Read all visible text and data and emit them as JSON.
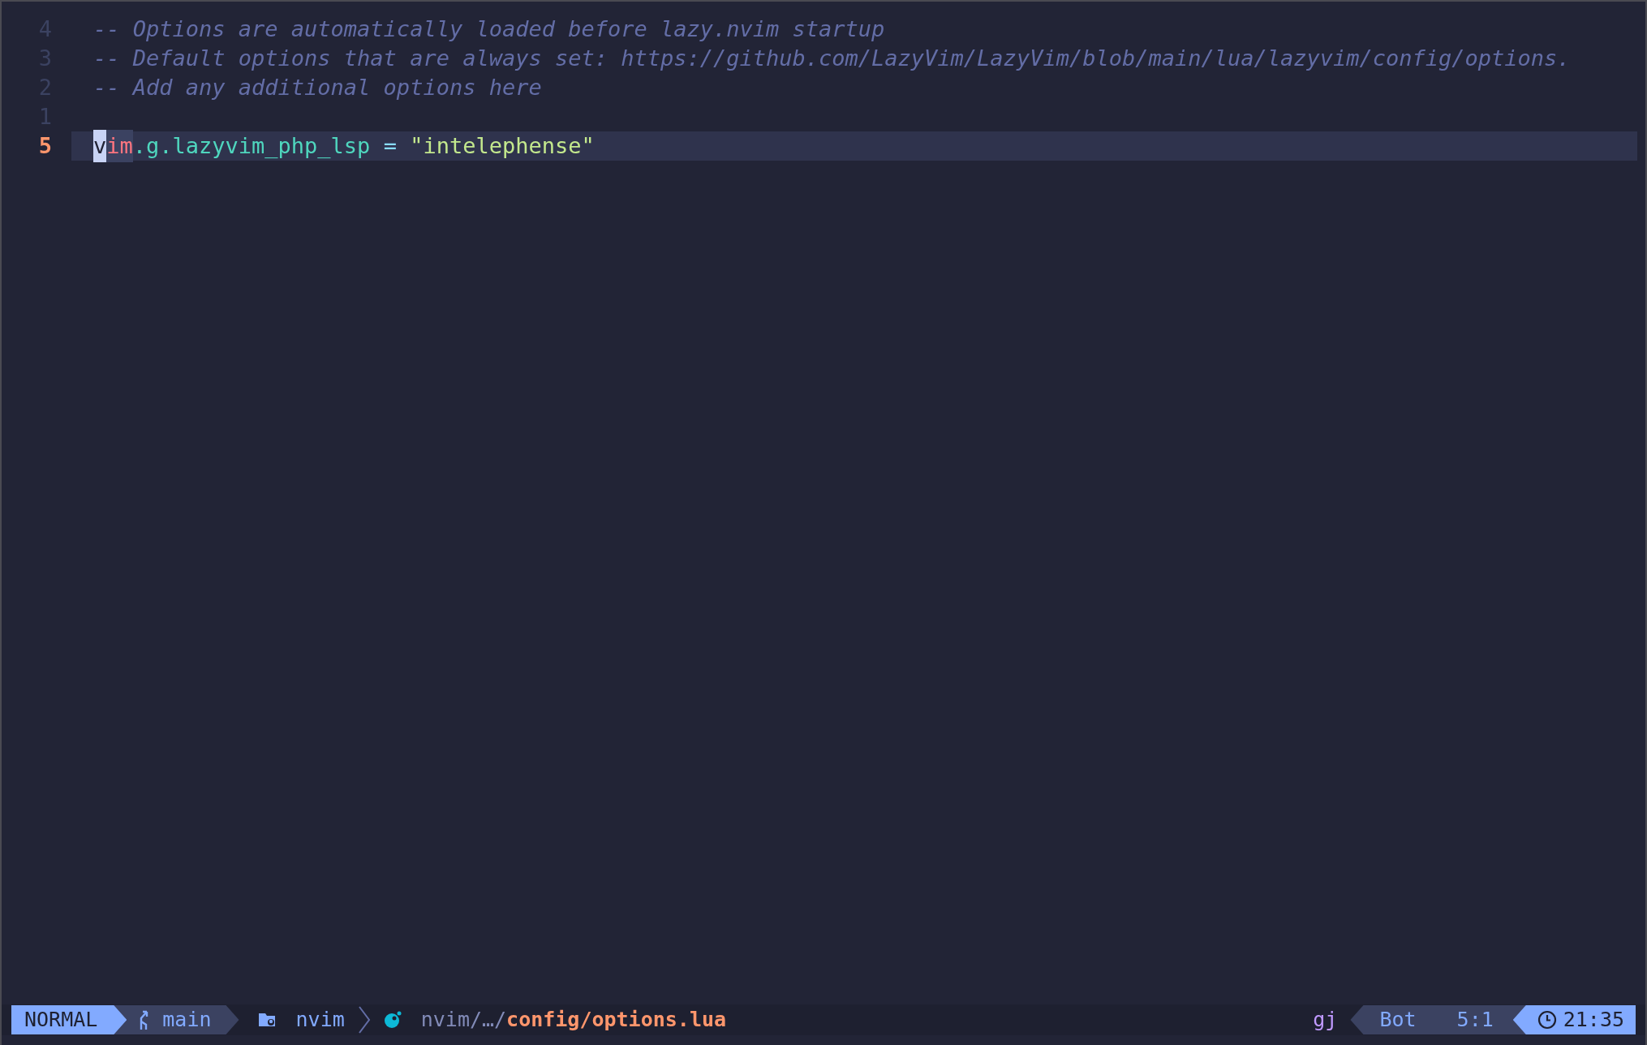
{
  "editor": {
    "lines": [
      {
        "number": "4",
        "current": false,
        "tokens": [
          {
            "kind": "comment",
            "text": "-- Options are automatically loaded before lazy.nvim startup"
          }
        ]
      },
      {
        "number": "3",
        "current": false,
        "tokens": [
          {
            "kind": "comment",
            "text": "-- Default options that are always set: https://github.com/LazyVim/LazyVim/blob/main/lua/lazyvim/config/options."
          }
        ]
      },
      {
        "number": "2",
        "current": false,
        "tokens": [
          {
            "kind": "comment",
            "text": "-- Add any additional options here"
          }
        ]
      },
      {
        "number": "1",
        "current": false
      },
      {
        "number": "5",
        "current": true,
        "tokens": [
          {
            "kind": "cursor",
            "text": "v"
          },
          {
            "kind": "builtin",
            "text": "im"
          },
          {
            "kind": "field",
            "text": ".g.lazyvim_php_lsp"
          },
          {
            "kind": "operator",
            "text": " = "
          },
          {
            "kind": "string",
            "text": "\"intelephense\""
          }
        ]
      }
    ]
  },
  "statusline": {
    "mode": "NORMAL",
    "branch": "main",
    "directory": "nvim",
    "file_dir": "nvim/…/",
    "file_name": "config/options.lua",
    "pending_keys": "gj",
    "progress": "Bot",
    "location": "5:1",
    "clock": "21:35"
  }
}
